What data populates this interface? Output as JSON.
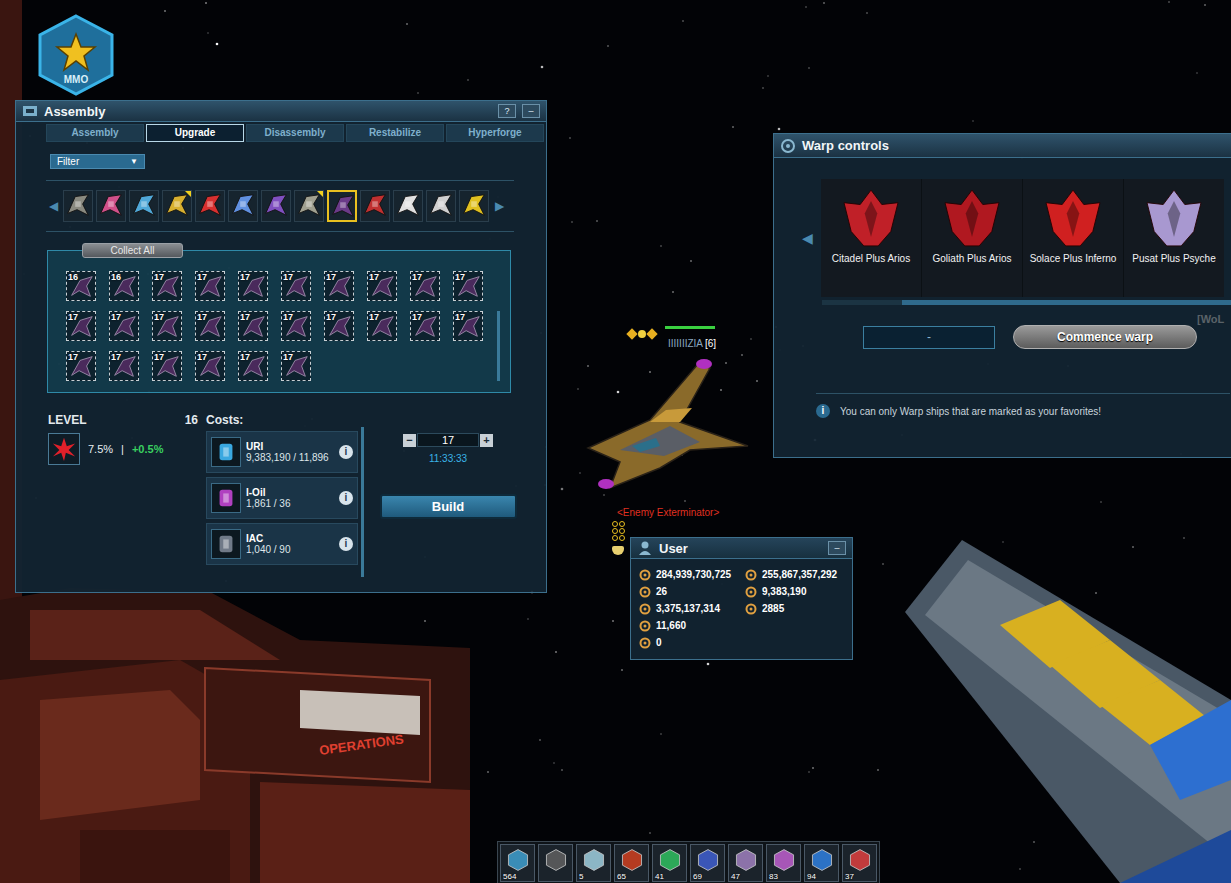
{
  "badge": {
    "label": "MMO"
  },
  "assembly": {
    "title": "Assembly",
    "help": "?",
    "minimize": "–",
    "tabs": [
      {
        "label": "Assembly",
        "selected": false
      },
      {
        "label": "Upgrade",
        "selected": true
      },
      {
        "label": "Disassembly",
        "selected": false
      },
      {
        "label": "Restabilize",
        "selected": false
      },
      {
        "label": "Hyperforge",
        "selected": false
      }
    ],
    "filter": {
      "label": "Filter",
      "arrow": "▼"
    },
    "strip": {
      "prev": "◀",
      "next": "▶",
      "items": [
        {
          "color": "#8a8a80",
          "selected": false,
          "marked": false
        },
        {
          "color": "#d0508a",
          "selected": false,
          "marked": false
        },
        {
          "color": "#50a8d8",
          "selected": false,
          "marked": false
        },
        {
          "color": "#d8b030",
          "selected": false,
          "marked": true
        },
        {
          "color": "#d83030",
          "selected": false,
          "marked": false
        },
        {
          "color": "#6090e0",
          "selected": false,
          "marked": false
        },
        {
          "color": "#8050c0",
          "selected": false,
          "marked": false
        },
        {
          "color": "#a0a090",
          "selected": false,
          "marked": true
        },
        {
          "color": "#6a3a88",
          "selected": true,
          "marked": false
        },
        {
          "color": "#c03030",
          "selected": false,
          "marked": false
        },
        {
          "color": "#e0e0e0",
          "selected": false,
          "marked": false
        },
        {
          "color": "#d0d0d0",
          "selected": false,
          "marked": false
        },
        {
          "color": "#e0c020",
          "selected": false,
          "marked": false
        }
      ]
    },
    "collect_all": "Collect All",
    "slots": [
      {
        "level": "16"
      },
      {
        "level": "16"
      },
      {
        "level": "17"
      },
      {
        "level": "17"
      },
      {
        "level": "17"
      },
      {
        "level": "17"
      },
      {
        "level": "17"
      },
      {
        "level": "17"
      },
      {
        "level": "17"
      },
      {
        "level": "17"
      },
      {
        "level": "17"
      },
      {
        "level": "17"
      },
      {
        "level": "17"
      },
      {
        "level": "17"
      },
      {
        "level": "17"
      },
      {
        "level": "17"
      },
      {
        "level": "17"
      },
      {
        "level": "17"
      },
      {
        "level": "17"
      },
      {
        "level": "17"
      },
      {
        "level": "17"
      },
      {
        "level": "17"
      },
      {
        "level": "17"
      },
      {
        "level": "17"
      },
      {
        "level": "17"
      },
      {
        "level": "17"
      }
    ],
    "level_label": "LEVEL",
    "level": "16",
    "bonus": "7.5%",
    "separator": "|",
    "bonus_next": "+0.5%",
    "costs_label": "Costs:",
    "costs": [
      {
        "name": "URI",
        "amount": "9,383,190 / 11,896",
        "color": "#3aa8e0"
      },
      {
        "name": "I-Oil",
        "amount": "1,861 / 36",
        "color": "#b040c0"
      },
      {
        "name": "IAC",
        "amount": "1,040 / 90",
        "color": "#707a88"
      }
    ],
    "info": "i",
    "counter": {
      "minus": "−",
      "value": "17",
      "plus": "+"
    },
    "timer": "11:33:33",
    "build": "Build"
  },
  "warp": {
    "title": "Warp controls",
    "prev": "◀",
    "ships": [
      {
        "name": "Citadel Plus Arios",
        "color": "#c02028"
      },
      {
        "name": "Goliath Plus Arios",
        "color": "#b01820"
      },
      {
        "name": "Solace Plus Inferno",
        "color": "#d02020"
      },
      {
        "name": "Pusat Plus Psyche",
        "color": "#a898d0"
      }
    ],
    "input": "-",
    "commence": "Commence warp",
    "info_icon": "i",
    "note": "You can only Warp ships that are marked as your favorites!",
    "cut_label": "[WoL"
  },
  "player": {
    "name": "IIIIIIIZIA",
    "clan": "[6]",
    "hp_level": 1.0,
    "enemy_label": "<Enemy Exterminator>"
  },
  "user_panel": {
    "title": "User",
    "minimize": "–",
    "rows": [
      {
        "cells": [
          {
            "value": "284,939,730,725"
          },
          {
            "value": "255,867,357,292"
          }
        ]
      },
      {
        "cells": [
          {
            "value": "26"
          },
          {
            "value": "9,383,190"
          }
        ]
      },
      {
        "cells": [
          {
            "value": "3,375,137,314"
          },
          {
            "value": "2885"
          }
        ]
      },
      {
        "cells": [
          {
            "value": "11,660"
          }
        ]
      },
      {
        "cells": [
          {
            "value": "0"
          }
        ]
      }
    ]
  },
  "action_bar": [
    {
      "count": "564",
      "color": "#40a0d0"
    },
    {
      "count": "",
      "color": "#606060"
    },
    {
      "count": "5",
      "color": "#a0d0e0"
    },
    {
      "count": "65",
      "color": "#d04020"
    },
    {
      "count": "41",
      "color": "#30c060"
    },
    {
      "count": "69",
      "color": "#4060d0"
    },
    {
      "count": "47",
      "color": "#a080c0"
    },
    {
      "count": "83",
      "color": "#c060d0"
    },
    {
      "count": "94",
      "color": "#3080e0"
    },
    {
      "count": "37",
      "color": "#e04040"
    }
  ],
  "scene": {
    "sign": "OPERATIONS"
  }
}
